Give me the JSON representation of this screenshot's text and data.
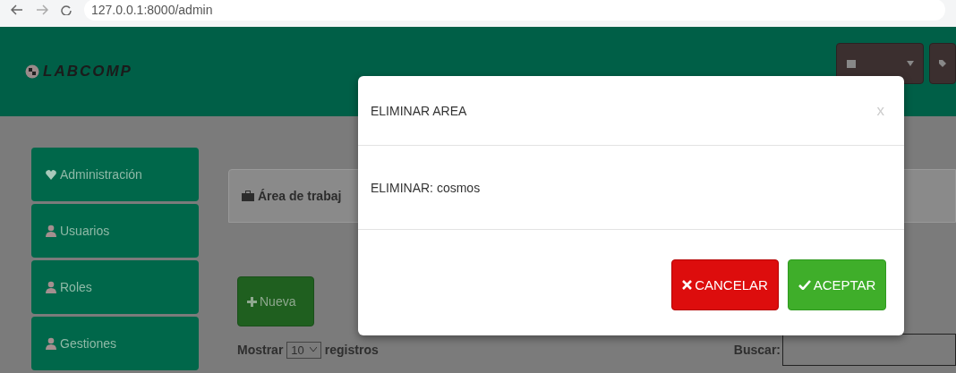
{
  "browser": {
    "url": "127.0.0.1:8000/admin"
  },
  "header": {
    "logo": "LABCOMP"
  },
  "sidebar": {
    "items": [
      {
        "label": "Administración",
        "kind": "section"
      },
      {
        "label": "Usuarios",
        "kind": "link"
      },
      {
        "label": "Roles",
        "kind": "link"
      },
      {
        "label": "Gestiones",
        "kind": "link"
      }
    ]
  },
  "panel": {
    "title": "Área de trabaj",
    "new_button": "Nueva",
    "show_label": "Mostrar",
    "page_size": "10",
    "records_label": "registros",
    "search_label": "Buscar:"
  },
  "modal": {
    "title": "ELIMINAR AREA",
    "close": "x",
    "body": "ELIMINAR: cosmos",
    "buttons": [
      {
        "label": "CANCELAR",
        "kind": "cancel"
      },
      {
        "label": "ACEPTAR",
        "kind": "accept"
      }
    ]
  }
}
